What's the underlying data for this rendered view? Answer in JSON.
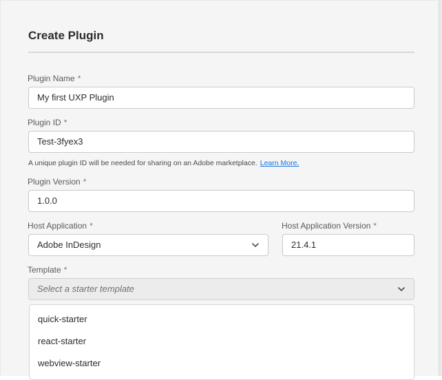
{
  "dialog": {
    "title": "Create Plugin"
  },
  "plugin_name": {
    "label": "Plugin Name",
    "value": "My first UXP Plugin"
  },
  "plugin_id": {
    "label": "Plugin ID",
    "value": "Test-3fyex3",
    "helper_text": "A unique plugin ID will be needed for sharing on an Adobe marketplace.",
    "learn_more_label": "Learn More."
  },
  "plugin_version": {
    "label": "Plugin Version",
    "value": "1.0.0"
  },
  "host_application": {
    "label": "Host Application",
    "selected": "Adobe InDesign"
  },
  "host_application_version": {
    "label": "Host Application Version",
    "value": "21.4.1"
  },
  "template": {
    "label": "Template",
    "placeholder": "Select a starter template",
    "options": [
      "quick-starter",
      "react-starter",
      "webview-starter"
    ]
  },
  "required_marker": "*",
  "colors": {
    "link": "#1473e6",
    "dialog_background": "#f5f5f5",
    "field_border": "#c9c9c9"
  }
}
